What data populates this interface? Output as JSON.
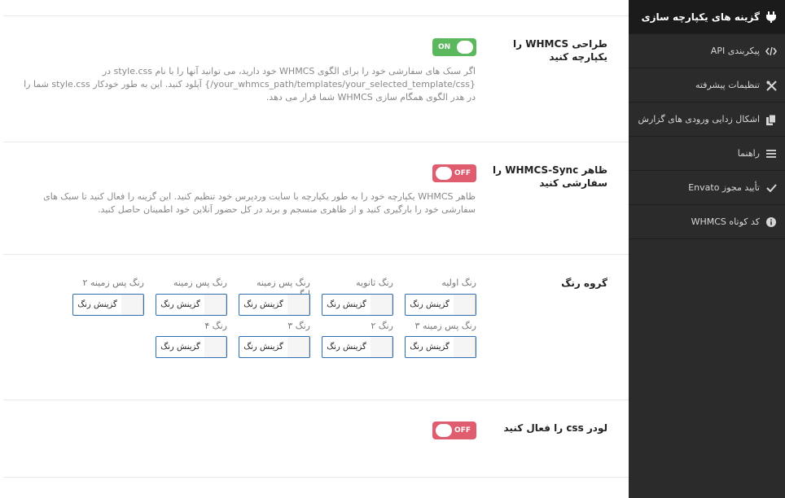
{
  "sections": {
    "seamless_design": {
      "title": "طراحی WHMCS را یکپارچه کنید",
      "description": "اگر سبک های سفارشی خود را برای الگوی WHMCS خود دارید، می توانید آنها را با نام style.css در {your_whmcs_path/templates/your_selected_template/css/} آپلود کنید. این به طور خودکار style.css شما را در هدر الگوی همگام سازی WHMCS شما قرار می دهد.",
      "toggle_label": "ON"
    },
    "custom_appearance": {
      "title": "ظاهر WHMCS-Sync را سفارشی کنید",
      "description": "ظاهر WHMCS یکپارچه خود را به طور یکپارچه با سایت وردپرس خود تنظیم کنید. این گزینه را فعال کنید تا سبک های سفارشی خود را بارگیری کنید و از ظاهری منسجم و برند در کل حضور آنلاین خود اطمینان حاصل کنید.",
      "toggle_label": "OFF"
    },
    "color_group": {
      "title": "گروه رنگ",
      "picker_text": "گزینش رنگ",
      "labels": [
        "رنگ اولیه",
        "رنگ ثانویه",
        "رنگ پس زمینه لنگر",
        "رنگ پس زمینه",
        "رنگ پس زمینه ۲",
        "رنگ پس زمینه ۳",
        "رنگ ۲",
        "رنگ ۳",
        "رنگ ۴"
      ]
    },
    "css_loader": {
      "title": "لودر css را فعال کنید",
      "toggle_label": "OFF"
    }
  },
  "sidebar": {
    "items": [
      {
        "label": "گزینه های یکپارچه سازی",
        "icon": "plug-icon"
      },
      {
        "label": "پیکربندی API",
        "icon": "code-icon"
      },
      {
        "label": "تنظیمات پیشرفته",
        "icon": "tools-icon"
      },
      {
        "label": "اشکال زدایی ورودی های گزارش",
        "icon": "copy-icon"
      },
      {
        "label": "راهنما",
        "icon": "menu-icon"
      },
      {
        "label": "تأیید مجوز Envato",
        "icon": "check-icon"
      },
      {
        "label": "کد کوتاه WHMCS",
        "icon": "info-icon"
      }
    ]
  },
  "colors": {
    "toggle_on": "#5cb85c",
    "toggle_off": "#e05d6f",
    "sidebar_bg": "#2b2b2b",
    "picker_border": "#2f6fb3"
  }
}
